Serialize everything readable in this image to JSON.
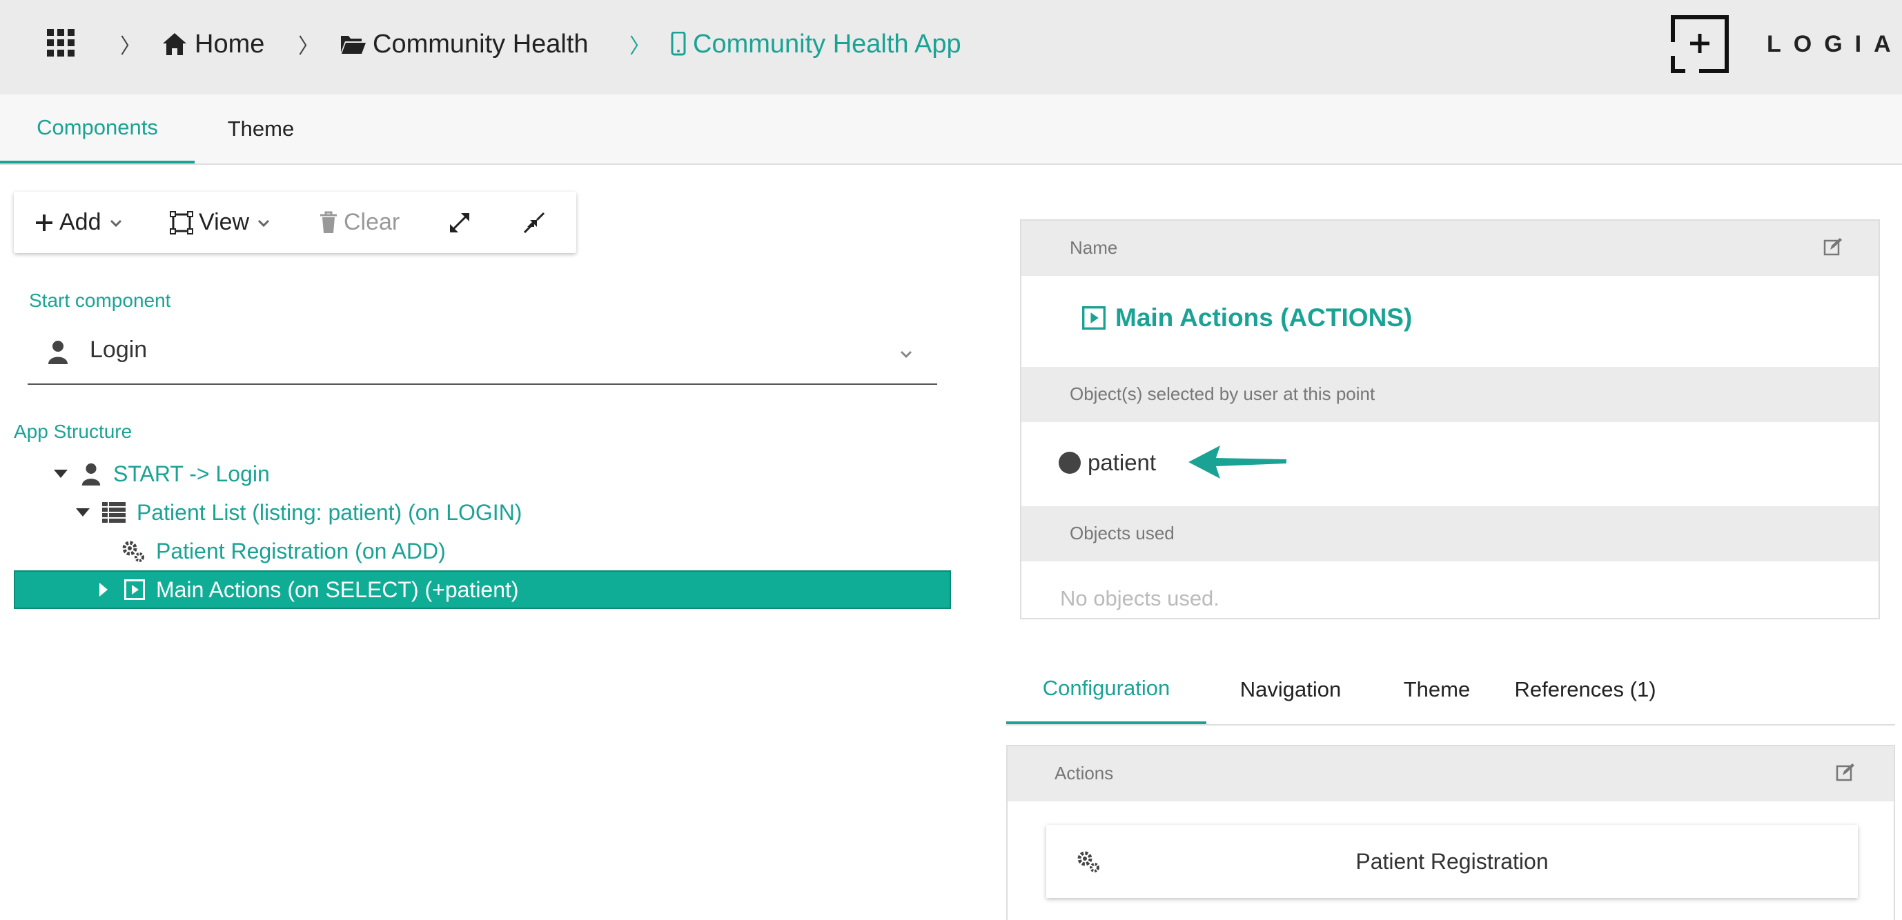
{
  "breadcrumb": {
    "home": "Home",
    "folder": "Community Health",
    "app": "Community Health App"
  },
  "logo": {
    "text": "LOGIAK"
  },
  "main_tabs": {
    "components": "Components",
    "theme": "Theme"
  },
  "toolbar": {
    "add_label": "Add",
    "view_label": "View",
    "clear_label": "Clear"
  },
  "start_component": {
    "label": "Start component",
    "value": "Login"
  },
  "app_structure": {
    "label": "App Structure",
    "items": [
      {
        "label": "START -> Login"
      },
      {
        "label": "Patient List (listing: patient) (on LOGIN)"
      },
      {
        "label": "Patient Registration (on ADD)"
      },
      {
        "label": "Main Actions (on SELECT) (+patient)"
      }
    ]
  },
  "details": {
    "name_header": "Name",
    "name_value": "Main Actions (ACTIONS)",
    "objects_selected_header": "Object(s) selected by user at this point",
    "object_selected": "patient",
    "objects_used_header": "Objects used",
    "objects_used_empty": "No objects used."
  },
  "config_tabs": {
    "configuration": "Configuration",
    "navigation": "Navigation",
    "theme": "Theme",
    "references": "References (1)"
  },
  "actions": {
    "header": "Actions",
    "items": [
      {
        "label": "Patient Registration"
      }
    ]
  },
  "colors": {
    "accent": "#1aa394",
    "selected_row": "#10ad96",
    "topbar": "#ebebeb"
  }
}
